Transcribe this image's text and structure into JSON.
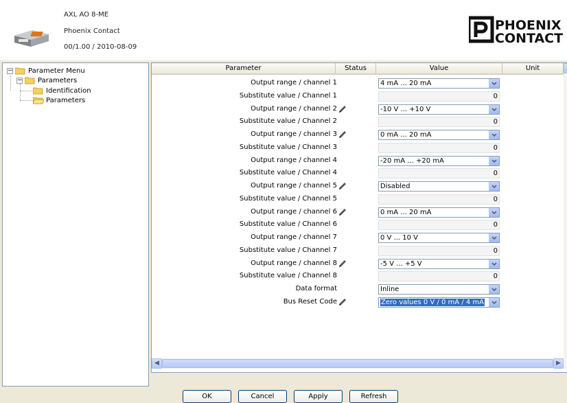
{
  "device": {
    "name": "AXL AO 8-ME",
    "vendor": "Phoenix Contact",
    "version": "00/1.00 / 2010-08-09",
    "logo_line1": "PHOENIX",
    "logo_line2": "CONTACT"
  },
  "tree": {
    "root": "Parameter Menu",
    "group": "Parameters",
    "items": [
      "Identification",
      "Parameters"
    ]
  },
  "grid": {
    "columns": {
      "parameter": "Parameter",
      "status": "Status",
      "value": "Value",
      "unit": "Unit"
    },
    "rows": [
      {
        "label": "Output range / channel 1",
        "type": "select",
        "value": "4 mA ... 20 mA",
        "edited": false
      },
      {
        "label": "Substitute value / Channel 1",
        "type": "number",
        "value": "0"
      },
      {
        "label": "Output range / channel 2",
        "type": "select",
        "value": "-10 V ... +10 V",
        "edited": true
      },
      {
        "label": "Substitute value / Channel 2",
        "type": "number",
        "value": "0"
      },
      {
        "label": "Output range / channel 3",
        "type": "select",
        "value": "0 mA ... 20 mA",
        "edited": true
      },
      {
        "label": "Substitute value / Channel 3",
        "type": "number",
        "value": "0"
      },
      {
        "label": "Output range / channel 4",
        "type": "select",
        "value": "-20 mA ... +20 mA",
        "edited": false
      },
      {
        "label": "Substitute value / Channel 4",
        "type": "number",
        "value": "0"
      },
      {
        "label": "Output range / channel 5",
        "type": "select",
        "value": "Disabled",
        "edited": true
      },
      {
        "label": "Substitute value / Channel 5",
        "type": "number",
        "value": "0"
      },
      {
        "label": "Output range / channel 6",
        "type": "select",
        "value": "0 mA ... 20 mA",
        "edited": true
      },
      {
        "label": "Substitute value / Channel 6",
        "type": "number",
        "value": "0"
      },
      {
        "label": "Output range / channel 7",
        "type": "select",
        "value": "0 V ... 10 V",
        "edited": false
      },
      {
        "label": "Substitute value / Channel 7",
        "type": "number",
        "value": "0"
      },
      {
        "label": "Output range / channel 8",
        "type": "select",
        "value": "-5 V ... +5 V",
        "edited": true
      },
      {
        "label": "Substitute value / Channel 8",
        "type": "number",
        "value": "0"
      },
      {
        "label": "Data format",
        "type": "select",
        "value": "Inline",
        "edited": false
      },
      {
        "label": "Bus Reset Code",
        "type": "select",
        "value": "Zero values 0 V / 0 mA / 4 mA",
        "edited": true,
        "highlighted": true
      }
    ]
  },
  "buttons": {
    "ok": "OK",
    "cancel": "Cancel",
    "apply": "Apply",
    "refresh": "Refresh"
  },
  "colors": {
    "selection": "#316ac5",
    "logo": "#111111"
  }
}
